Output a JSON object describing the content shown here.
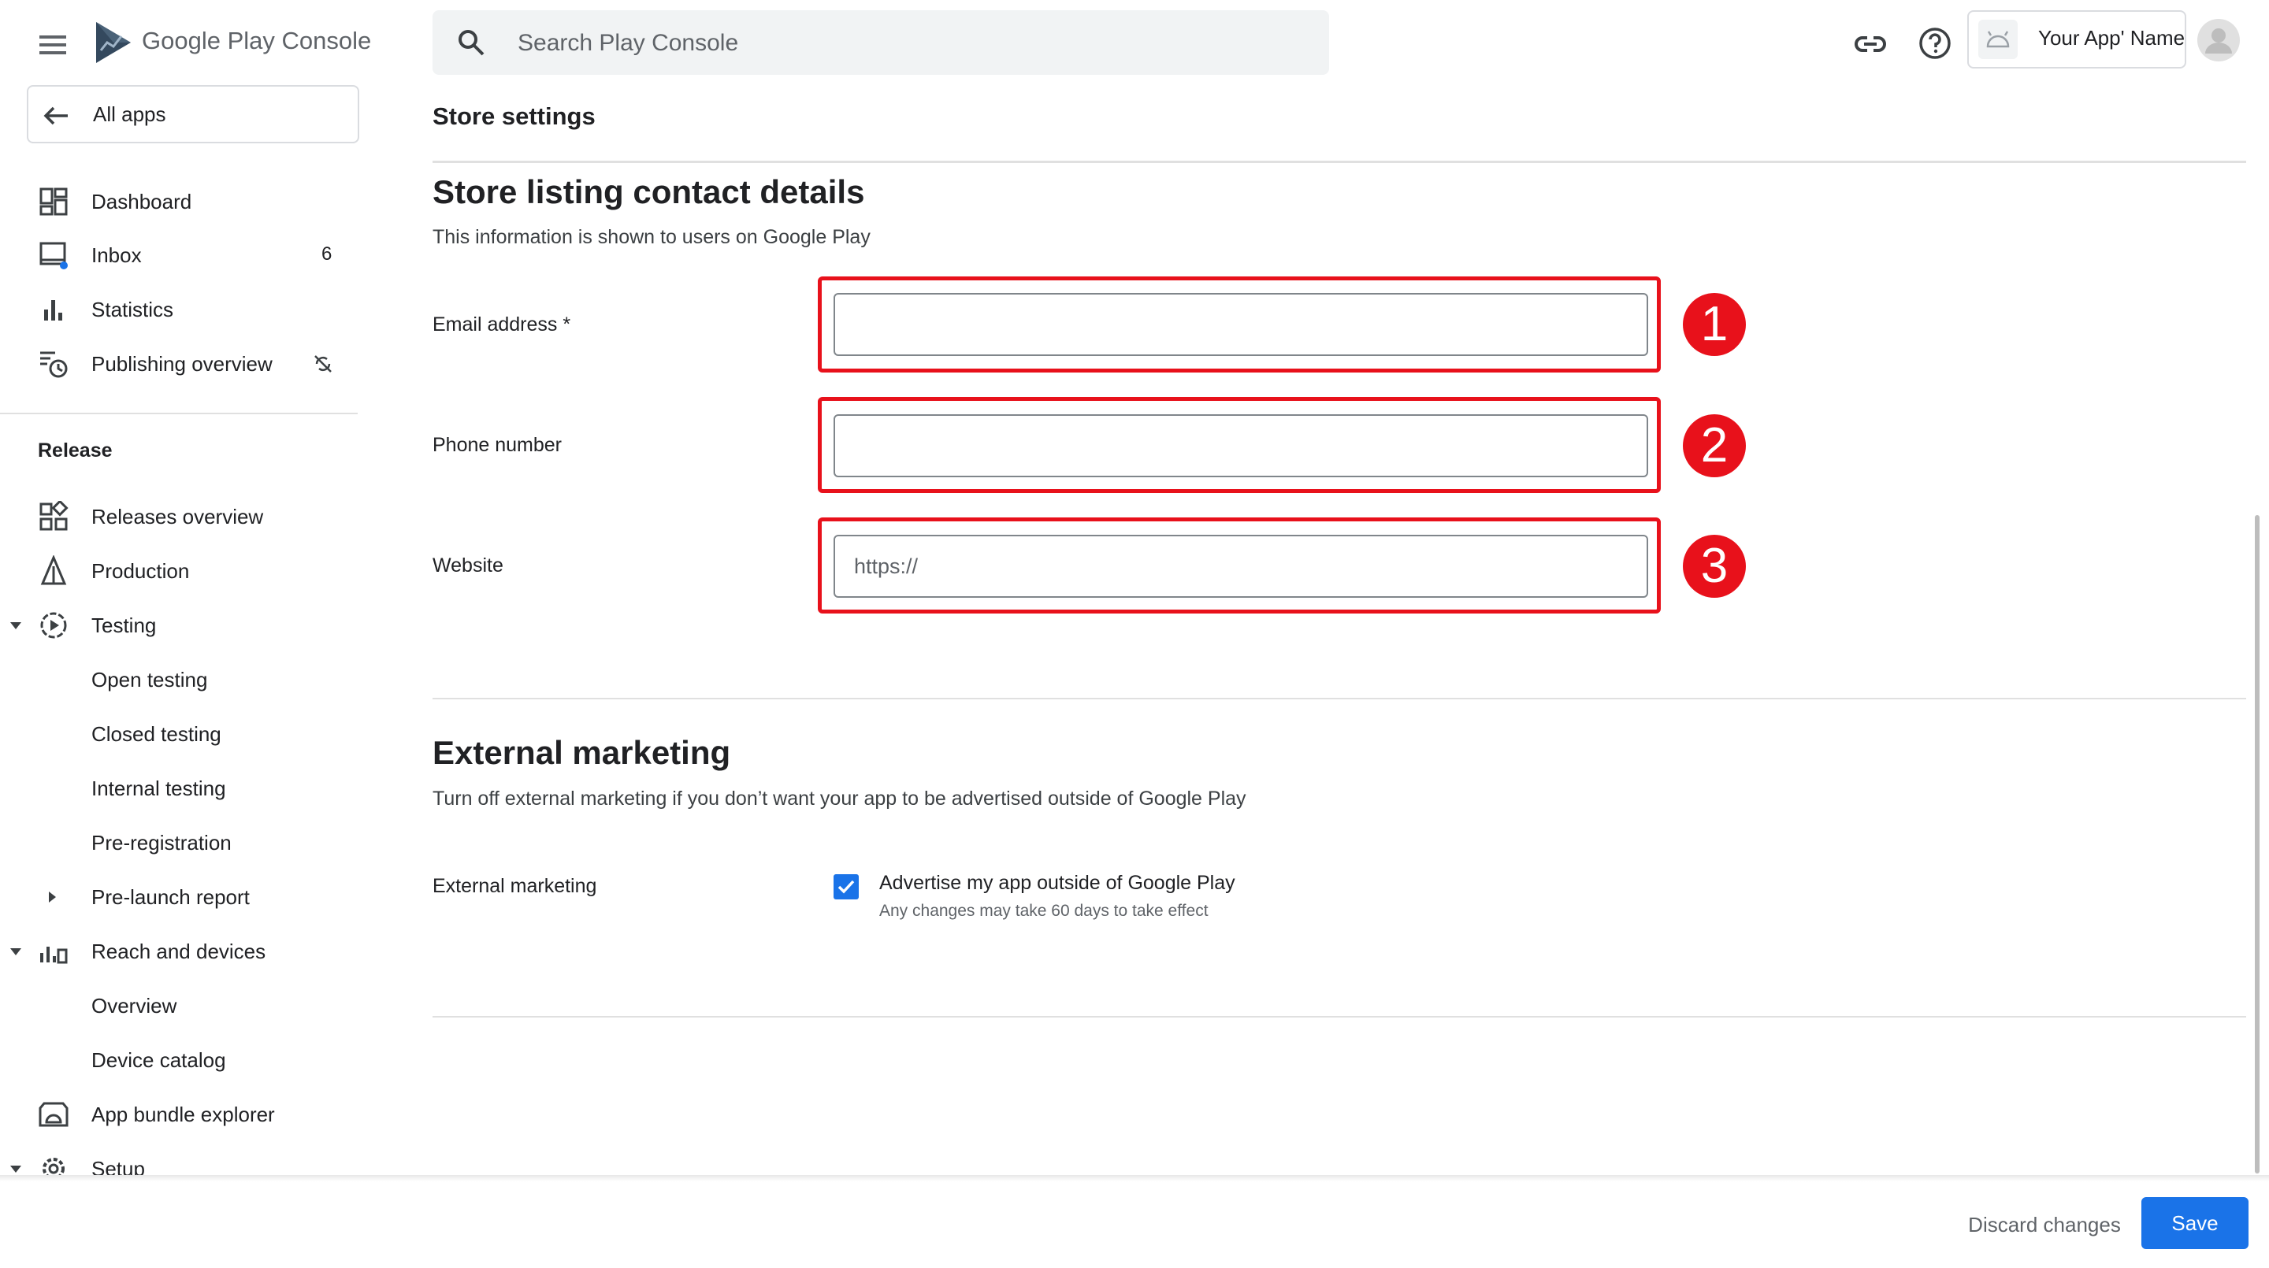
{
  "header": {
    "product_name": "Google Play Console",
    "search_placeholder": "Search Play Console",
    "app_name": "Your App' Name"
  },
  "sidebar": {
    "all_apps_label": "All apps",
    "top_items": [
      {
        "label": "Dashboard",
        "icon": "dashboard-icon"
      },
      {
        "label": "Inbox",
        "icon": "inbox-icon",
        "count": "6"
      },
      {
        "label": "Statistics",
        "icon": "bar-chart-icon"
      },
      {
        "label": "Publishing overview",
        "icon": "publishing-overview-icon"
      }
    ],
    "release_heading": "Release",
    "release_items": [
      {
        "label": "Releases overview",
        "icon": "releases-overview-icon"
      },
      {
        "label": "Production",
        "icon": "production-icon"
      },
      {
        "label": "Testing",
        "icon": "testing-icon",
        "expanded": true
      },
      {
        "label": "Open testing"
      },
      {
        "label": "Closed testing"
      },
      {
        "label": "Internal testing"
      },
      {
        "label": "Pre-registration"
      },
      {
        "label": "Pre-launch report",
        "expanded": false
      },
      {
        "label": "Reach and devices",
        "icon": "reach-devices-icon",
        "expanded": true
      },
      {
        "label": "Overview"
      },
      {
        "label": "Device catalog"
      },
      {
        "label": "App bundle explorer",
        "icon": "app-bundle-icon"
      },
      {
        "label": "Setup",
        "icon": "gear-icon",
        "expanded": true
      }
    ]
  },
  "main": {
    "page_title": "Store settings",
    "contact": {
      "heading": "Store listing contact details",
      "description": "This information is shown to users on Google Play",
      "email_label": "Email address  *",
      "email_value": "",
      "phone_label": "Phone number",
      "phone_value": "",
      "website_label": "Website",
      "website_placeholder": "https://",
      "badges": [
        "1",
        "2",
        "3"
      ],
      "highlight_color": "#e8111b"
    },
    "marketing": {
      "heading": "External marketing",
      "description": "Turn off external marketing if you don’t want your app to be advertised outside of Google Play",
      "label": "External marketing",
      "checkbox_label": "Advertise my app outside of Google Play",
      "checkbox_checked": true,
      "checkbox_help": "Any changes may take 60 days to take effect"
    }
  },
  "footer": {
    "discard_label": "Discard changes",
    "save_label": "Save",
    "accent_color": "#1a73e8"
  }
}
